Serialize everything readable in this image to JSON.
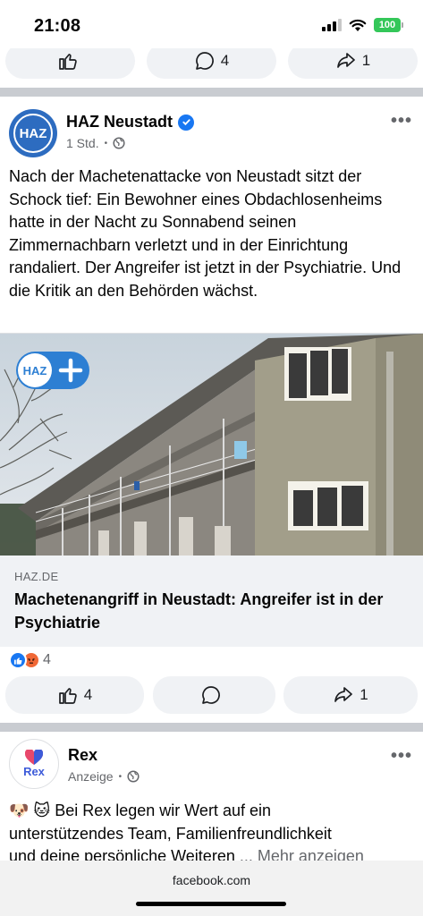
{
  "status_bar": {
    "time": "21:08",
    "battery": "100"
  },
  "top_post_actions": {
    "like_count": "",
    "comment_count": "4",
    "share_count": "1"
  },
  "post": {
    "page_name": "HAZ Neustadt",
    "avatar_text": "HAZ",
    "time": "1 Std.",
    "separator": "•",
    "text": "Nach der Machetenattacke von Neustadt sitzt der Schock tief: Ein Bewohner eines Obdachlosenheims hatte in der Nacht zu Sonnabend seinen Zimmernachbarn verletzt und in der Einrichtung randaliert. Der Angreifer ist jetzt in der Psychiatrie. Und die Kritik an den Behörden wächst.",
    "image_badge": "HAZ",
    "link_domain": "HAZ.DE",
    "link_title": "Machetenangriff in Neustadt: Angreifer ist in der Psychiatrie",
    "reaction_count": "4",
    "like_count": "4",
    "comment_count": "",
    "share_count": "1"
  },
  "ad": {
    "name": "Rex",
    "avatar_text": "Rex",
    "label": "Anzeige",
    "separator": "•",
    "emojis": "🐶 🐱",
    "text_line1": "Bei Rex legen wir Wert auf ein",
    "text_line2": "unterstützendes Team, Familienfreundlichkeit",
    "text_line3": "und deine persönliche Weiteren",
    "more_label": "... Mehr anzeigen"
  },
  "browser": {
    "url": "facebook.com"
  },
  "colors": {
    "facebook_blue": "#1877f2",
    "battery_green": "#34c759",
    "rex_pink": "#e8486b"
  },
  "icons": [
    "like-icon",
    "comment-icon",
    "share-icon",
    "verified-icon",
    "globe-icon",
    "more-icon",
    "angry-icon"
  ]
}
